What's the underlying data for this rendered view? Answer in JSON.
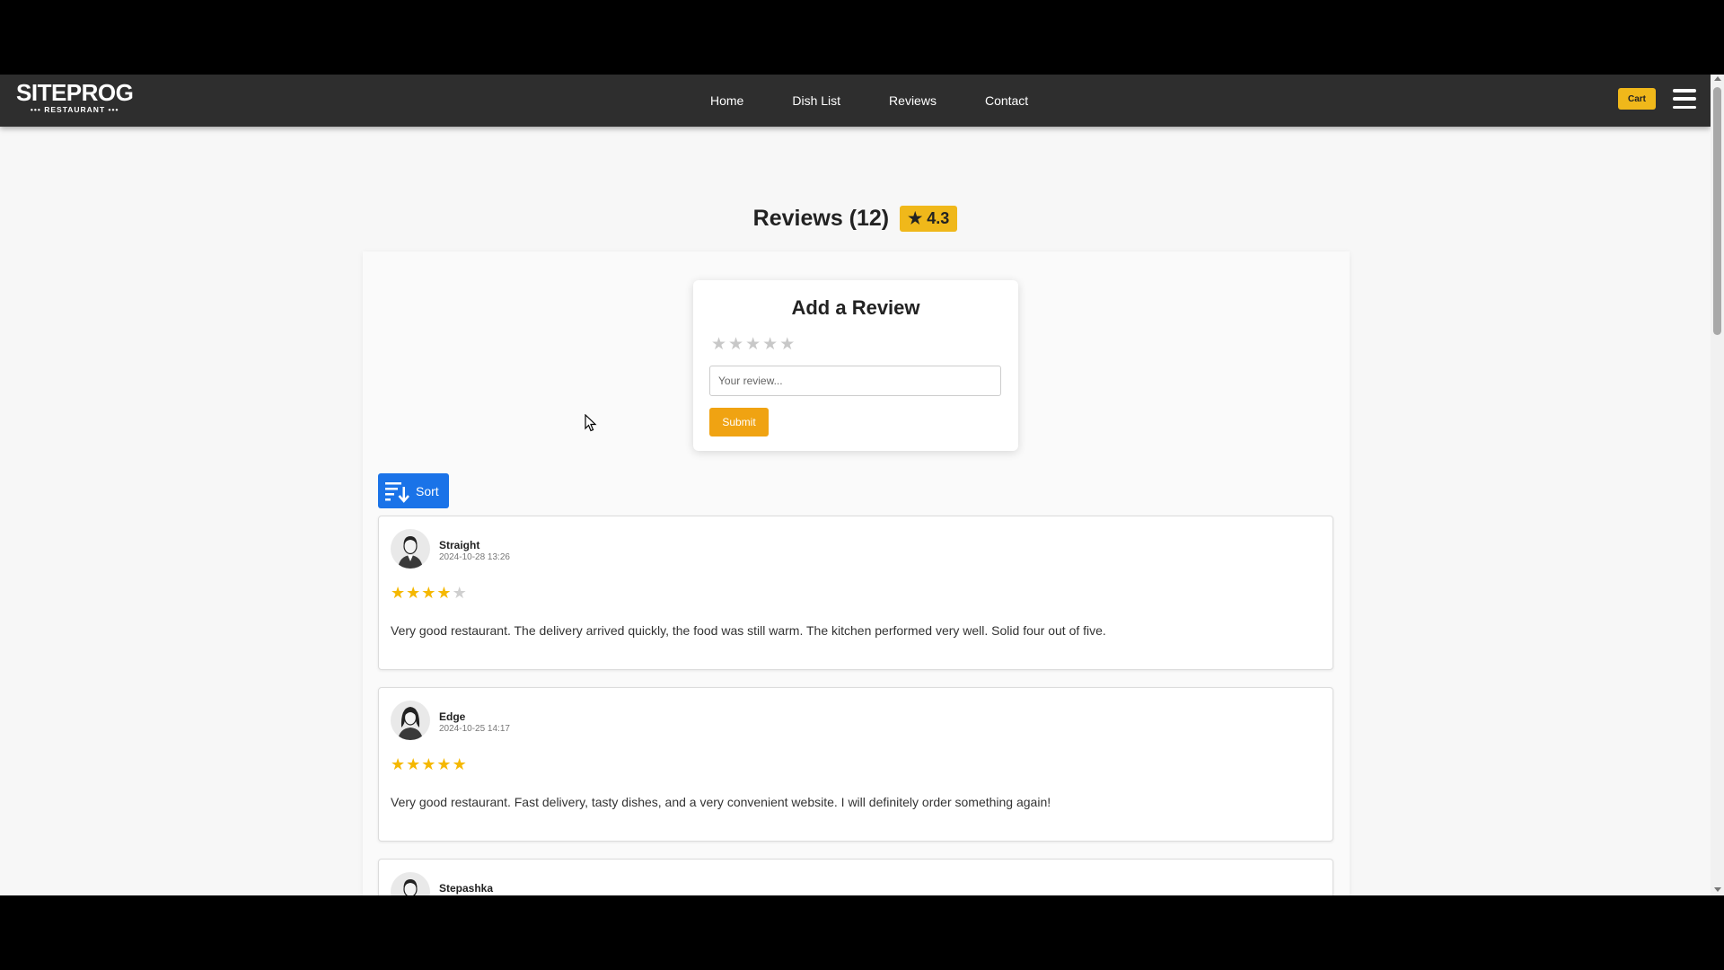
{
  "header": {
    "logo_main": "SITEPROG",
    "logo_sub": "••• RESTAURANT •••",
    "nav": [
      {
        "label": "Home"
      },
      {
        "label": "Dish List"
      },
      {
        "label": "Reviews"
      },
      {
        "label": "Contact"
      }
    ],
    "cart_label": "Cart",
    "menu_icon": "hamburger-menu-icon"
  },
  "page": {
    "title": "Reviews (12)",
    "average_rating": "★ 4.3",
    "average_rating_value": 4.3,
    "review_count": 12
  },
  "add_review": {
    "title": "Add a Review",
    "stars": 5,
    "selected_stars": 0,
    "placeholder": "Your review...",
    "value": "",
    "submit_label": "Submit"
  },
  "sort": {
    "label": "Sort",
    "icon": "sort-descending-icon"
  },
  "reviews": [
    {
      "name": "Straight",
      "date": "2024-10-28 13:26",
      "rating": 4,
      "text": "Very good restaurant. The delivery arrived quickly, the food was still warm. The kitchen performed very well. Solid four out of five.",
      "avatar": "male-avatar-icon"
    },
    {
      "name": "Edge",
      "date": "2024-10-25 14:17",
      "rating": 5,
      "text": "Very good restaurant. Fast delivery, tasty dishes, and a very convenient website. I will definitely order something again!",
      "avatar": "female-avatar-icon"
    },
    {
      "name": "Stepashka",
      "date": "",
      "rating": 0,
      "text": "",
      "avatar": "male-avatar-icon"
    }
  ],
  "colors": {
    "header_bg": "#2e2e2e",
    "accent_yellow": "#f0b81a",
    "submit_orange": "#f0a312",
    "sort_blue": "#1a73e8",
    "star_on": "#f5b800",
    "star_off": "#cfcfcf"
  }
}
